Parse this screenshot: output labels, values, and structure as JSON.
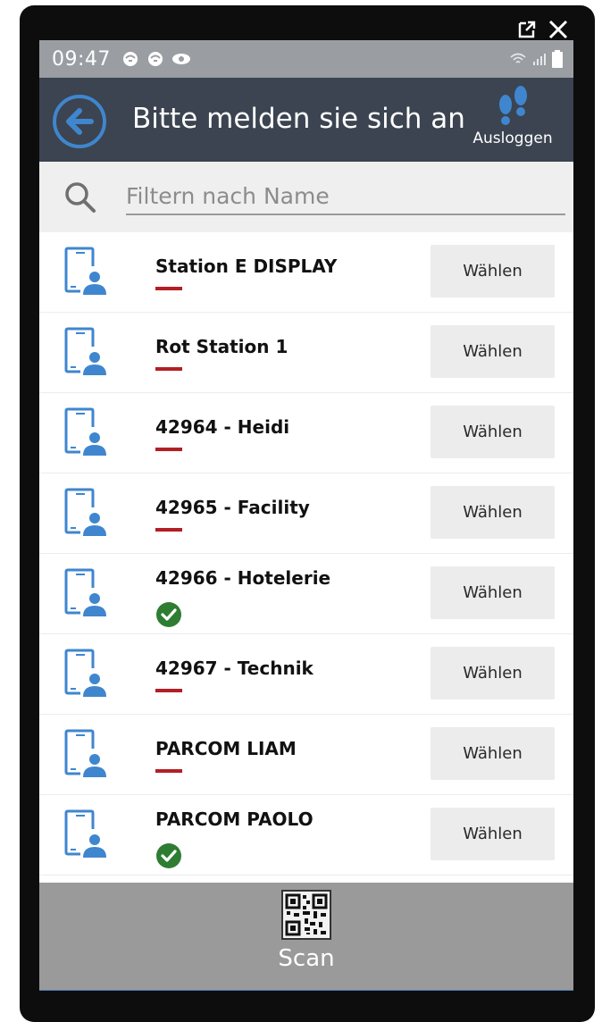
{
  "statusbar": {
    "time": "09:47",
    "left_icons": [
      "notification-icon",
      "notification-icon",
      "eye-icon"
    ],
    "right_icons": [
      "wifi-icon",
      "signal-icon",
      "battery-icon"
    ]
  },
  "appbar": {
    "title": "Bitte melden sie sich an",
    "logout_label": "Ausloggen",
    "back_icon": "back-arrow-icon",
    "logout_icon": "footprints-icon"
  },
  "filter": {
    "placeholder": "Filtern nach Name",
    "value": ""
  },
  "devices": [
    {
      "name": "Station E DISPLAY",
      "status": "inactive",
      "button": "Wählen"
    },
    {
      "name": "Rot Station 1",
      "status": "inactive",
      "button": "Wählen"
    },
    {
      "name": "42964 - Heidi",
      "status": "inactive",
      "button": "Wählen"
    },
    {
      "name": "42965 - Facility",
      "status": "inactive",
      "button": "Wählen"
    },
    {
      "name": "42966 - Hotelerie",
      "status": "active",
      "button": "Wählen"
    },
    {
      "name": "42967 - Technik",
      "status": "inactive",
      "button": "Wählen"
    },
    {
      "name": "PARCOM LIAM",
      "status": "inactive",
      "button": "Wählen"
    },
    {
      "name": "PARCOM PAOLO",
      "status": "active",
      "button": "Wählen"
    }
  ],
  "bottombar": {
    "scan_label": "Scan",
    "scan_icon": "qr-code-icon"
  },
  "colors": {
    "appbar": "#3b4450",
    "statusbar": "#9a9ea3",
    "accent_blue": "#3f86cf",
    "inactive_red": "#b21f24",
    "active_green": "#2e7d32"
  }
}
